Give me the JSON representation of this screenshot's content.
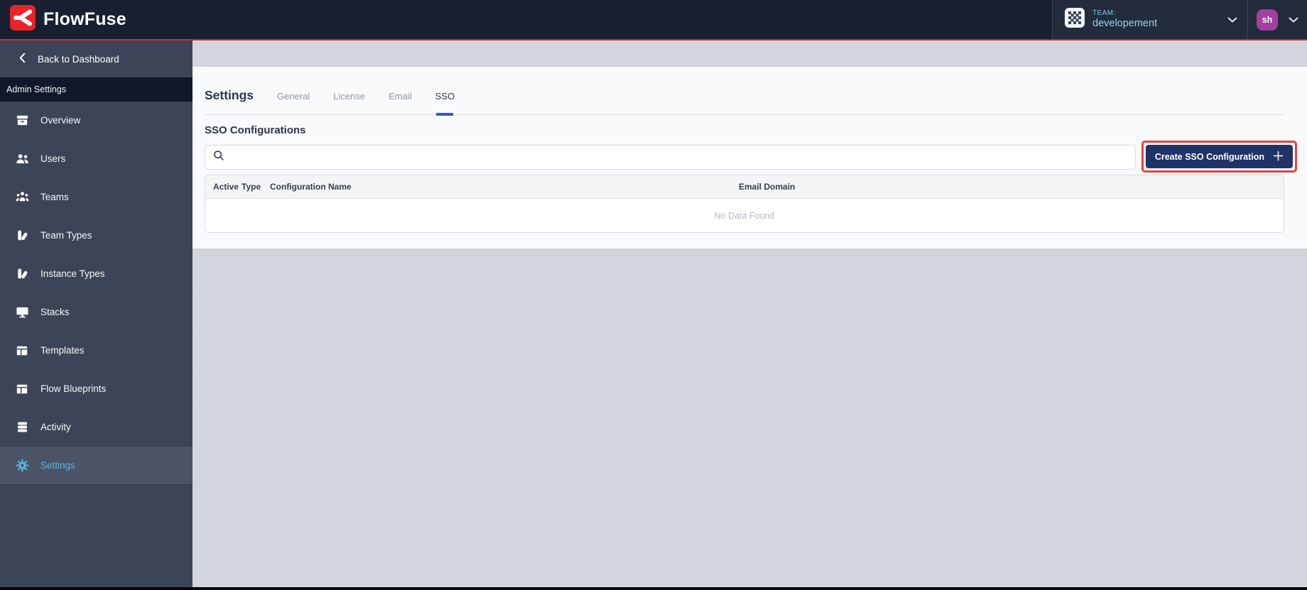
{
  "header": {
    "brand": "FlowFuse",
    "team": {
      "label": "TEAM:",
      "name": "developement"
    },
    "avatar_initials": "sh"
  },
  "sidebar": {
    "back_label": "Back to Dashboard",
    "section_label": "Admin Settings",
    "items": [
      {
        "label": "Overview",
        "icon": "archive-box-icon",
        "active": false
      },
      {
        "label": "Users",
        "icon": "users-icon",
        "active": false
      },
      {
        "label": "Teams",
        "icon": "user-group-icon",
        "active": false
      },
      {
        "label": "Team Types",
        "icon": "pills-icon",
        "active": false
      },
      {
        "label": "Instance Types",
        "icon": "pills-icon",
        "active": false
      },
      {
        "label": "Stacks",
        "icon": "desktop-icon",
        "active": false
      },
      {
        "label": "Templates",
        "icon": "table-layout-icon",
        "active": false
      },
      {
        "label": "Flow Blueprints",
        "icon": "table-layout-icon",
        "active": false
      },
      {
        "label": "Activity",
        "icon": "database-icon",
        "active": false
      },
      {
        "label": "Settings",
        "icon": "gear-icon",
        "active": true
      }
    ]
  },
  "main": {
    "title": "Settings",
    "tabs": [
      {
        "label": "General",
        "active": false
      },
      {
        "label": "License",
        "active": false
      },
      {
        "label": "Email",
        "active": false
      },
      {
        "label": "SSO",
        "active": true
      }
    ],
    "section_title": "SSO Configurations",
    "search": {
      "value": ""
    },
    "create_button_label": "Create SSO Configuration",
    "table": {
      "columns": [
        "Active",
        "Type",
        "Configuration Name",
        "Email Domain"
      ],
      "rows": [],
      "empty_text": "No Data Found"
    }
  },
  "colors": {
    "brand_red": "#e8232a",
    "header_bg": "#171f30",
    "top_divider_red": "#d9262c",
    "sidebar_bg": "#3c4557",
    "sidebar_active_bg": "#4b5466",
    "accent_blue": "#5ab3e2",
    "team_text_blue": "#8fd6ee",
    "avatar_purple": "#a23f9f",
    "tab_underline_blue": "#3a54c4",
    "button_navy": "#1f3366",
    "annotation_red": "#e8413c",
    "main_bg_gray": "#d2d5dc",
    "panel_bg": "#f9fafb"
  }
}
